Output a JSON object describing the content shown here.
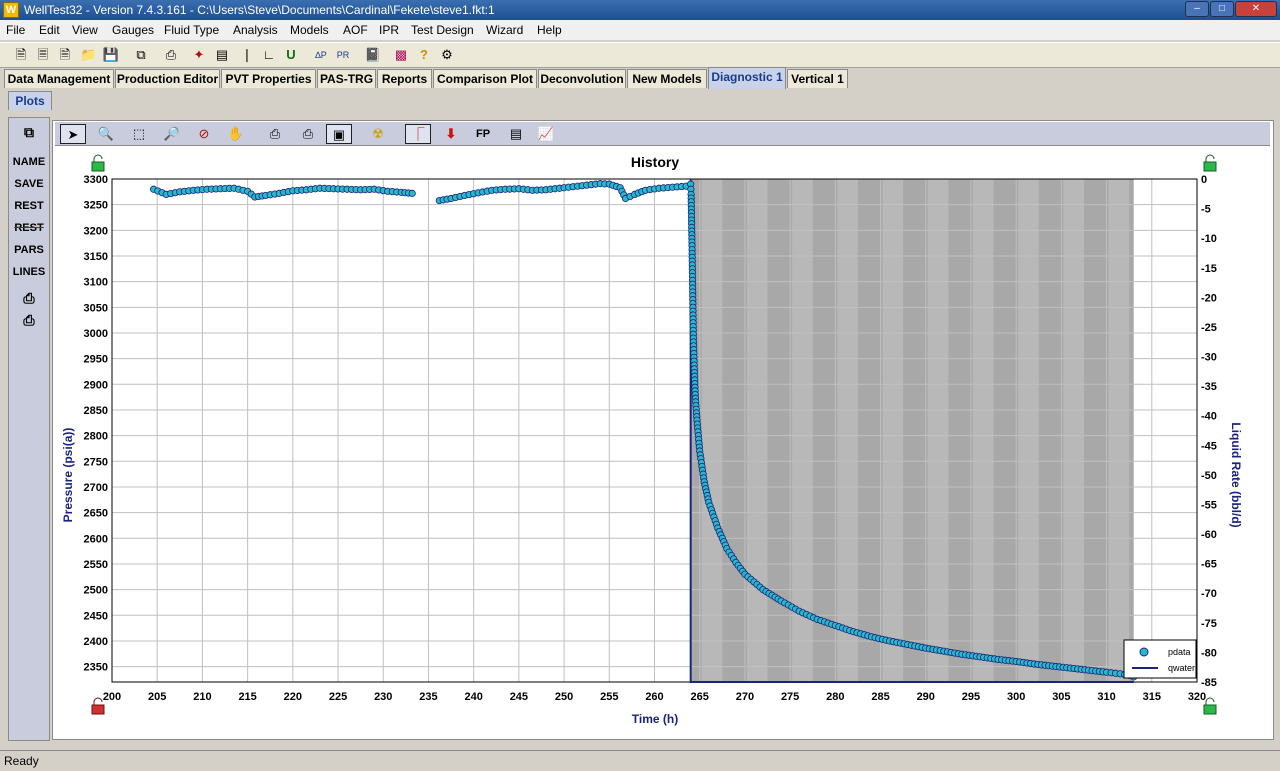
{
  "window": {
    "title": "WellTest32 - Version 7.4.3.161 - C:\\Users\\Steve\\Documents\\Cardinal\\Fekete\\steve1.fkt:1",
    "app_icon_letter": "W"
  },
  "menu": [
    "File",
    "Edit",
    "View",
    "Gauges",
    "Fluid Type",
    "Analysis",
    "Models",
    "AOF",
    "IPR",
    "Test Design",
    "Wizard",
    "Help"
  ],
  "tabs": [
    "Data Management",
    "Production Editor",
    "PVT Properties",
    "PAS-TRG",
    "Reports",
    "Comparison Plot",
    "Deconvolution",
    "New Models",
    "Diagnostic 1",
    "Vertical 1"
  ],
  "active_tab": "Diagnostic 1",
  "subtab": "Plots",
  "sidebar": {
    "buttons": [
      "NAME",
      "SAVE",
      "REST",
      "REST",
      "PARS",
      "LINES"
    ]
  },
  "plot_toolbar": {
    "fp_label": "FP"
  },
  "status": "Ready",
  "colors": {
    "accent": "#1a3b8c",
    "pdata": "#29b8c8",
    "shade": "#a8a8a8",
    "band": "#b8b8b8",
    "axis": "#1a237e"
  },
  "chart_data": {
    "type": "scatter",
    "title": "History",
    "xlabel": "Time (h)",
    "ylabel": "Pressure (psi(a))",
    "y2label": "Liquid Rate (bbl/d)",
    "xlim": [
      200,
      320
    ],
    "ylim": [
      2320,
      3300
    ],
    "y2lim": [
      -85,
      0
    ],
    "xticks": [
      200,
      205,
      210,
      215,
      220,
      225,
      230,
      235,
      240,
      245,
      250,
      255,
      260,
      265,
      270,
      275,
      280,
      285,
      290,
      295,
      300,
      305,
      310,
      315,
      320
    ],
    "yticks": [
      2350,
      2400,
      2450,
      2500,
      2550,
      2600,
      2650,
      2700,
      2750,
      2800,
      2850,
      2900,
      2950,
      3000,
      3050,
      3100,
      3150,
      3200,
      3250,
      3300
    ],
    "y2ticks": [
      0,
      -5,
      -10,
      -15,
      -20,
      -25,
      -30,
      -35,
      -40,
      -45,
      -50,
      -55,
      -60,
      -65,
      -70,
      -75,
      -80,
      -85
    ],
    "grid": true,
    "legend": {
      "position": "bottom-right",
      "entries": [
        "pdata",
        "qwater"
      ]
    },
    "rate_step": {
      "x_start": 264.0,
      "x_end": 313.0,
      "value": -85
    },
    "series": [
      {
        "name": "pdata",
        "points": [
          [
            204.6,
            3280
          ],
          [
            206.0,
            3270
          ],
          [
            207.5,
            3275
          ],
          [
            209.0,
            3278
          ],
          [
            210.5,
            3280
          ],
          [
            212.0,
            3281
          ],
          [
            213.5,
            3282
          ],
          [
            215.0,
            3276
          ],
          [
            215.8,
            3265
          ],
          [
            217.0,
            3268
          ],
          [
            218.5,
            3272
          ],
          [
            220.0,
            3277
          ],
          [
            221.5,
            3279
          ],
          [
            223.0,
            3282
          ],
          [
            224.5,
            3281
          ],
          [
            226.0,
            3280
          ],
          [
            227.5,
            3279
          ],
          [
            229.0,
            3280
          ],
          [
            230.5,
            3276
          ],
          [
            232.0,
            3274
          ],
          [
            233.2,
            3272
          ],
          [
            236.2,
            3258
          ],
          [
            237.5,
            3262
          ],
          [
            239.0,
            3268
          ],
          [
            240.5,
            3273
          ],
          [
            242.0,
            3278
          ],
          [
            243.5,
            3280
          ],
          [
            245.0,
            3281
          ],
          [
            246.5,
            3278
          ],
          [
            248.0,
            3279
          ],
          [
            249.5,
            3282
          ],
          [
            251.0,
            3285
          ],
          [
            252.5,
            3288
          ],
          [
            254.0,
            3291
          ],
          [
            255.0,
            3290
          ],
          [
            256.2,
            3283
          ],
          [
            256.8,
            3262
          ],
          [
            257.8,
            3270
          ],
          [
            259.0,
            3278
          ],
          [
            260.5,
            3282
          ],
          [
            262.0,
            3284
          ],
          [
            263.5,
            3286
          ],
          [
            264.0,
            3290
          ],
          [
            264.05,
            3270
          ],
          [
            264.1,
            3220
          ],
          [
            264.15,
            3170
          ],
          [
            264.2,
            3110
          ],
          [
            264.25,
            3050
          ],
          [
            264.3,
            2990
          ],
          [
            264.4,
            2930
          ],
          [
            264.5,
            2880
          ],
          [
            264.7,
            2830
          ],
          [
            265.0,
            2770
          ],
          [
            265.5,
            2710
          ],
          [
            266.0,
            2670
          ],
          [
            267.0,
            2620
          ],
          [
            268.0,
            2580
          ],
          [
            269.0,
            2553
          ],
          [
            270.0,
            2530
          ],
          [
            272.0,
            2500
          ],
          [
            274.0,
            2478
          ],
          [
            276.0,
            2458
          ],
          [
            278.0,
            2442
          ],
          [
            280.0,
            2430
          ],
          [
            282.0,
            2418
          ],
          [
            284.0,
            2408
          ],
          [
            286.0,
            2400
          ],
          [
            288.0,
            2393
          ],
          [
            290.0,
            2386
          ],
          [
            292.0,
            2380
          ],
          [
            294.0,
            2374
          ],
          [
            296.0,
            2369
          ],
          [
            298.0,
            2364
          ],
          [
            300.0,
            2360
          ],
          [
            302.0,
            2355
          ],
          [
            304.0,
            2351
          ],
          [
            306.0,
            2347
          ],
          [
            308.0,
            2343
          ],
          [
            310.0,
            2339
          ],
          [
            311.5,
            2336
          ],
          [
            312.5,
            2333
          ],
          [
            313.0,
            2330
          ]
        ]
      }
    ]
  }
}
